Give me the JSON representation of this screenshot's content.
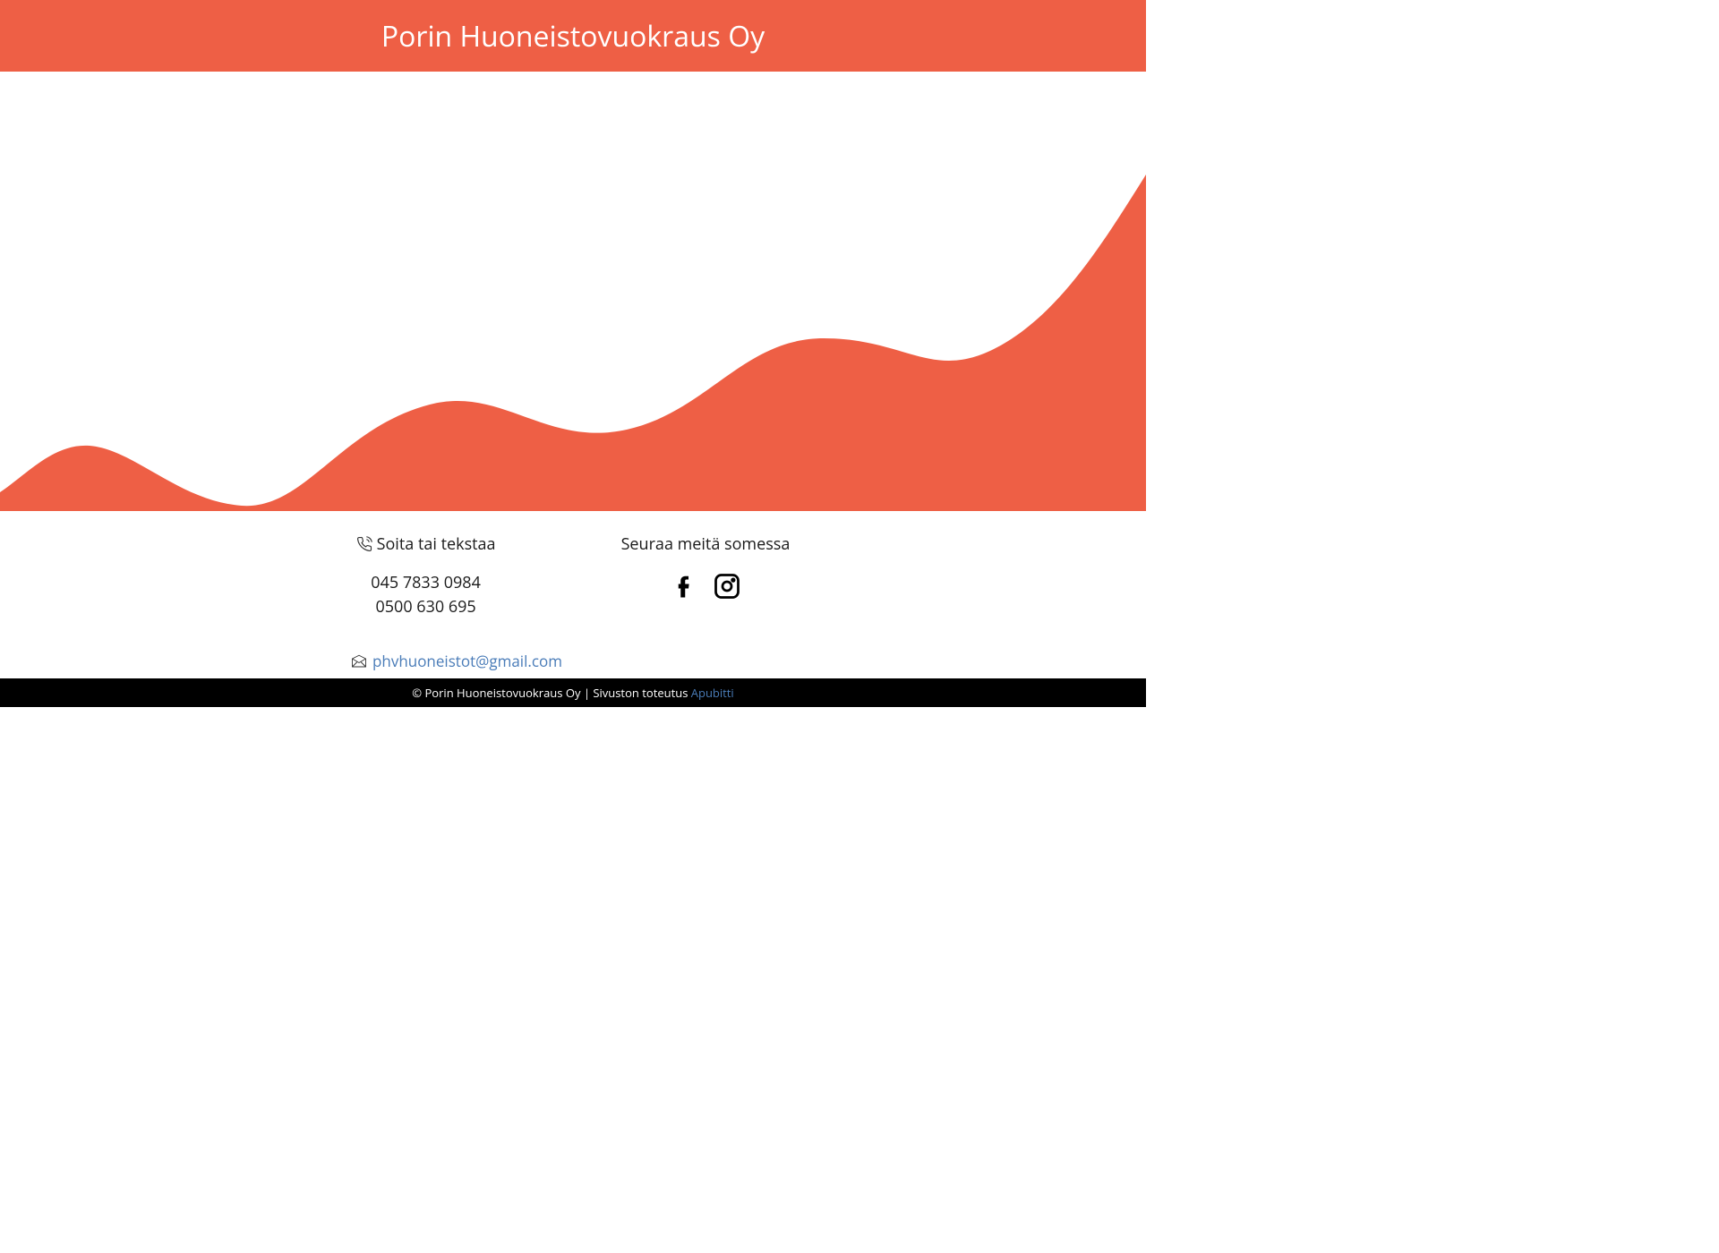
{
  "header": {
    "title": "Porin Huoneistovuokraus Oy"
  },
  "contact": {
    "phone_heading": "Soita tai tekstaa",
    "phone1": "045 7833 0984",
    "phone2": "0500 630 695",
    "email": "phvhuoneistot@gmail.com"
  },
  "social": {
    "heading": "Seuraa meitä somessa"
  },
  "footer": {
    "copyright": "© Porin Huoneistovuokraus Oy | Sivuston toteutus ",
    "link_text": "Apubitti"
  },
  "colors": {
    "primary": "#ee5f45",
    "link": "#4a7cb8"
  }
}
